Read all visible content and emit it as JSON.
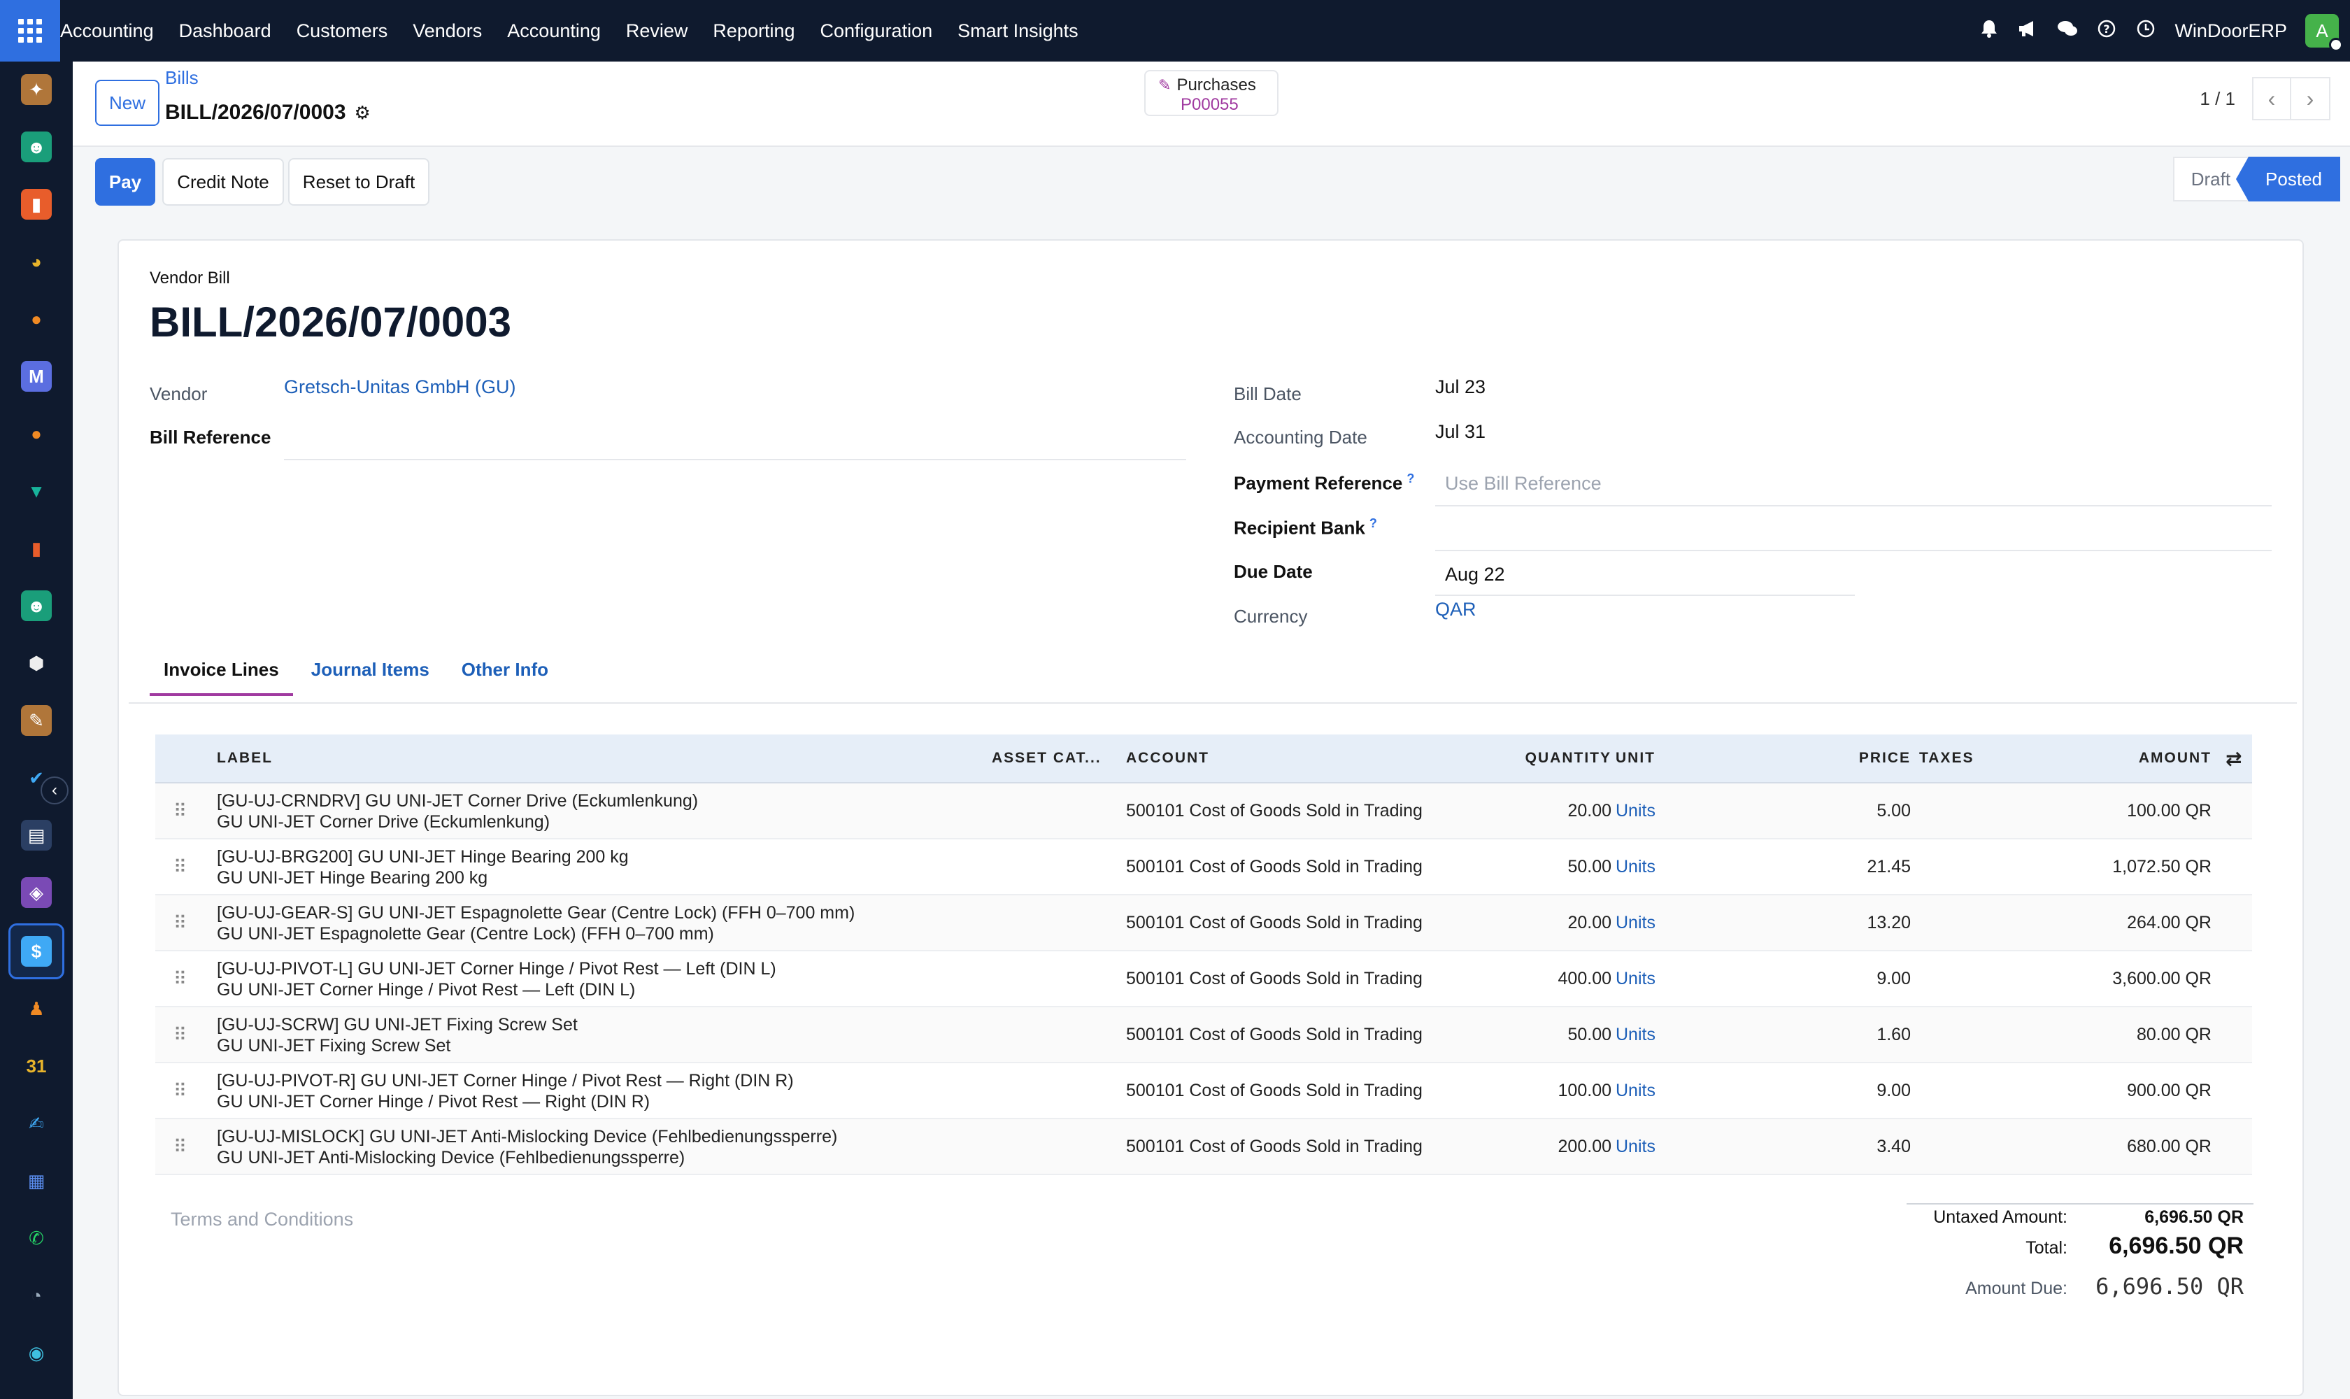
{
  "topbar": {
    "brand": "Accounting",
    "menu": [
      "Dashboard",
      "Customers",
      "Vendors",
      "Accounting",
      "Review",
      "Reporting",
      "Configuration",
      "Smart Insights"
    ],
    "company": "WinDoorERP",
    "avatar_letter": "A"
  },
  "control_panel": {
    "new_label": "New",
    "breadcrumb_parent": "Bills",
    "record_name": "BILL/2026/07/0003",
    "smart_button": {
      "label": "Purchases",
      "value": "P00055"
    },
    "pager": "1 / 1"
  },
  "statusbar": {
    "buttons": [
      "Pay",
      "Credit Note",
      "Reset to Draft"
    ],
    "stages": [
      "Draft",
      "Posted"
    ],
    "current_stage": "Posted"
  },
  "form": {
    "doc_type": "Vendor Bill",
    "title": "BILL/2026/07/0003",
    "left": {
      "vendor_label": "Vendor",
      "vendor_value": "Gretsch-Unitas GmbH (GU)",
      "bill_ref_label": "Bill Reference",
      "bill_ref_value": ""
    },
    "right": {
      "bill_date_label": "Bill Date",
      "bill_date_value": "Jul 23",
      "acc_date_label": "Accounting Date",
      "acc_date_value": "Jul 31",
      "pay_ref_label": "Payment Reference",
      "pay_ref_placeholder": "Use Bill Reference",
      "bank_label": "Recipient Bank",
      "due_label": "Due Date",
      "due_value": "Aug 22",
      "currency_label": "Currency",
      "currency_value": "QAR",
      "help_mark": "?"
    }
  },
  "tabs": [
    "Invoice Lines",
    "Journal Items",
    "Other Info"
  ],
  "table": {
    "headers": {
      "label": "LABEL",
      "asset": "ASSET CAT...",
      "account": "ACCOUNT",
      "quantity": "QUANTITY",
      "unit": "UNIT",
      "price": "PRICE",
      "taxes": "TAXES",
      "amount": "AMOUNT"
    },
    "rows": [
      {
        "l1": "[GU-UJ-CRNDRV] GU UNI-JET Corner Drive (Eckumlenkung)",
        "l2": "GU UNI-JET Corner Drive (Eckumlenkung)",
        "account": "500101 Cost of Goods Sold in Trading",
        "qty": "20.00",
        "unit": "Units",
        "price": "5.00",
        "amount": "100.00 QR"
      },
      {
        "l1": "[GU-UJ-BRG200] GU UNI-JET Hinge Bearing 200 kg",
        "l2": "GU UNI-JET Hinge Bearing 200 kg",
        "account": "500101 Cost of Goods Sold in Trading",
        "qty": "50.00",
        "unit": "Units",
        "price": "21.45",
        "amount": "1,072.50 QR"
      },
      {
        "l1": "[GU-UJ-GEAR-S] GU UNI-JET Espagnolette Gear (Centre Lock) (FFH 0–700 mm)",
        "l2": "GU UNI-JET Espagnolette Gear (Centre Lock) (FFH 0–700 mm)",
        "account": "500101 Cost of Goods Sold in Trading",
        "qty": "20.00",
        "unit": "Units",
        "price": "13.20",
        "amount": "264.00 QR"
      },
      {
        "l1": "[GU-UJ-PIVOT-L] GU UNI-JET Corner Hinge / Pivot Rest — Left (DIN L)",
        "l2": "GU UNI-JET Corner Hinge / Pivot Rest — Left (DIN L)",
        "account": "500101 Cost of Goods Sold in Trading",
        "qty": "400.00",
        "unit": "Units",
        "price": "9.00",
        "amount": "3,600.00 QR"
      },
      {
        "l1": "[GU-UJ-SCRW] GU UNI-JET Fixing Screw Set",
        "l2": "GU UNI-JET Fixing Screw Set",
        "account": "500101 Cost of Goods Sold in Trading",
        "qty": "50.00",
        "unit": "Units",
        "price": "1.60",
        "amount": "80.00 QR"
      },
      {
        "l1": "[GU-UJ-PIVOT-R] GU UNI-JET Corner Hinge / Pivot Rest — Right (DIN R)",
        "l2": "GU UNI-JET Corner Hinge / Pivot Rest — Right (DIN R)",
        "account": "500101 Cost of Goods Sold in Trading",
        "qty": "100.00",
        "unit": "Units",
        "price": "9.00",
        "amount": "900.00 QR"
      },
      {
        "l1": "[GU-UJ-MISLOCK] GU UNI-JET Anti-Mislocking Device (Fehlbedienungssperre)",
        "l2": "GU UNI-JET Anti-Mislocking Device (Fehlbedienungssperre)",
        "account": "500101 Cost of Goods Sold in Trading",
        "qty": "200.00",
        "unit": "Units",
        "price": "3.40",
        "amount": "680.00 QR"
      }
    ]
  },
  "terms_placeholder": "Terms and Conditions",
  "totals": {
    "untaxed_label": "Untaxed Amount:",
    "untaxed_value": "6,696.50 QR",
    "total_label": "Total:",
    "total_value": "6,696.50 QR",
    "due_label": "Amount Due:",
    "due_value": "6,696.50 QR"
  },
  "sidebar_icons": [
    "discuss-icon",
    "contacts-icon",
    "reporting-icon",
    "dashboard-icon",
    "chat-icon",
    "mail-icon",
    "livechat-icon",
    "project-icon",
    "sales-icon",
    "employees-icon",
    "inventory-icon",
    "notes-icon",
    "todo-icon",
    "knowledge-icon",
    "purchase-icon",
    "accounting-icon",
    "team-icon",
    "calendar-icon",
    "sign-icon",
    "apps-icon",
    "whatsapp-icon",
    "timer-icon",
    "website-icon"
  ]
}
